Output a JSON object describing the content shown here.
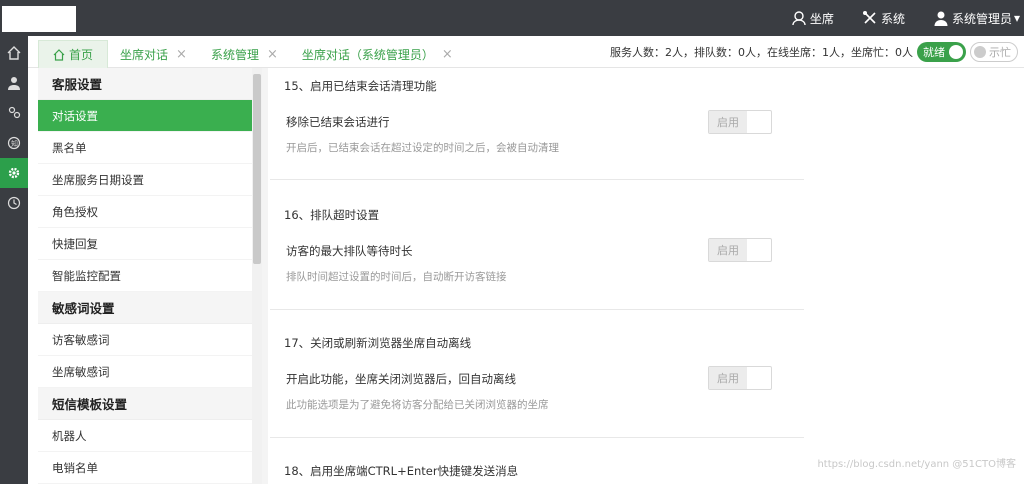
{
  "topnav": {
    "agent": "坐席",
    "system": "系统",
    "user": "系统管理员"
  },
  "tabs": [
    {
      "label": "首页"
    },
    {
      "label": "坐席对话"
    },
    {
      "label": "系统管理"
    },
    {
      "label": "坐席对话（系统管理员）"
    }
  ],
  "stats": {
    "text": "服务人数：2人，排队数：0人，在线坐席：1人，坐席忙：0人",
    "ready": "就绪",
    "show": "示忙"
  },
  "sidebar": {
    "group1": "客服设置",
    "items1": [
      "对话设置",
      "黑名单",
      "坐席服务日期设置",
      "角色授权",
      "快捷回复",
      "智能监控配置"
    ],
    "group2": "敏感词设置",
    "items2": [
      "访客敏感词",
      "坐席敏感词"
    ],
    "group3": "短信模板设置",
    "items3": [
      "机器人",
      "电销名单"
    ]
  },
  "sections": [
    {
      "title": "15、启用已结束会话清理功能",
      "label": "移除已结束会话进行",
      "desc": "开启后，已结束会话在超过设定的时间之后，会被自动清理",
      "toggle": "启用"
    },
    {
      "title": "16、排队超时设置",
      "label": "访客的最大排队等待时长",
      "desc": "排队时间超过设置的时间后，自动断开访客链接",
      "toggle": "启用"
    },
    {
      "title": "17、关闭或刷新浏览器坐席自动离线",
      "label": "开启此功能，坐席关闭浏览器后，回自动离线",
      "desc": "此功能选项是为了避免将访客分配给已关闭浏览器的坐席",
      "toggle": "启用"
    },
    {
      "title": "18、启用坐席端CTRL+Enter快捷键发送消息"
    }
  ],
  "watermark": "https://blog.csdn.net/yann   @51CTO博客"
}
